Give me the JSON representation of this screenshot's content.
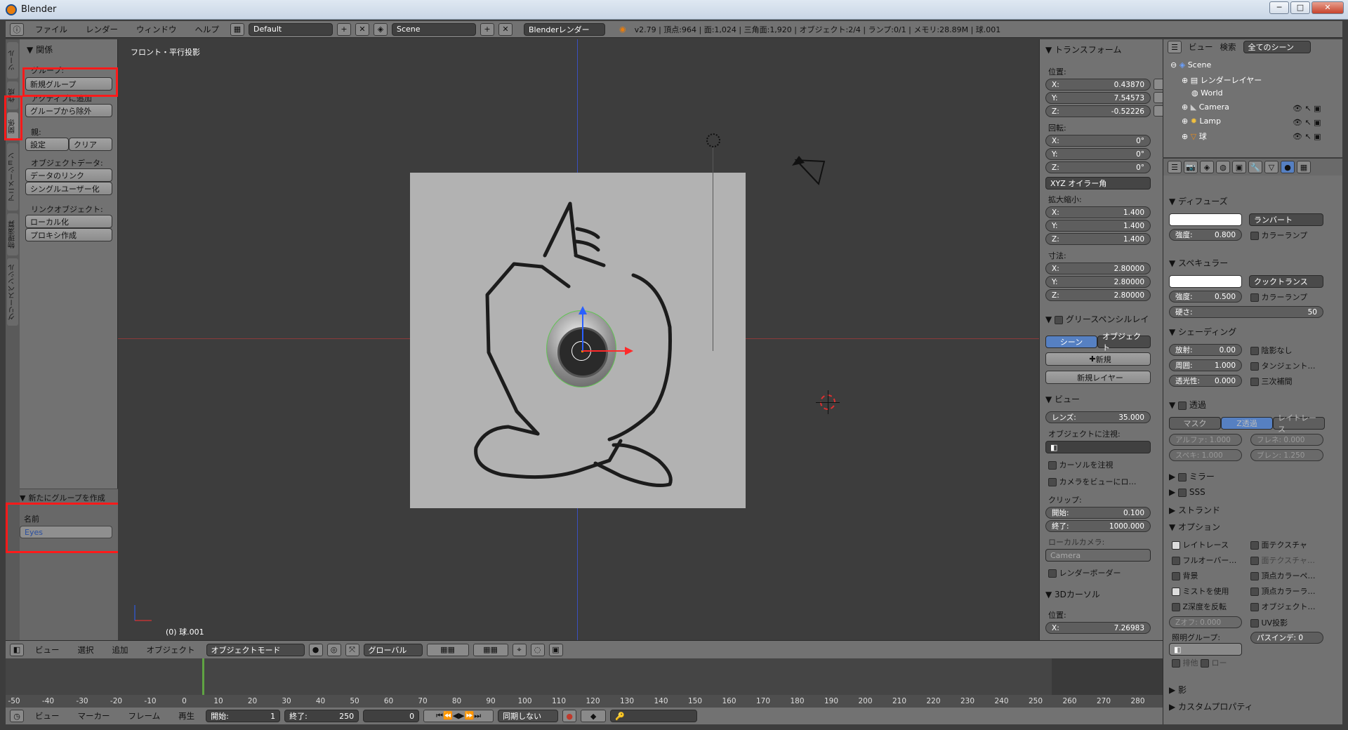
{
  "window": {
    "title": "Blender",
    "min": "─",
    "max": "□",
    "close": "✕"
  },
  "topbar": {
    "menus": [
      "ファイル",
      "レンダー",
      "ウィンドウ",
      "ヘルプ"
    ],
    "layout": "Default",
    "scene": "Scene",
    "engine": "Blenderレンダー",
    "stats": "v2.79 | 頂点:964 | 面:1,024 | 三角面:1,920 | オブジェクト:2/4 | ランプ:0/1 | メモリ:28.89M | 球.001"
  },
  "tool": {
    "tabs": [
      "ツール",
      "作成",
      "関係",
      "アニメーション",
      "物理演算",
      "グリースペンシル"
    ],
    "panel_title": "関係",
    "group_label": "グループ:",
    "btn_new_group": "新規グループ",
    "btn_add_active": "アクティブに追加",
    "btn_remove_group": "グループから除外",
    "parent_label": "親:",
    "btn_set": "設定",
    "btn_clear": "クリア",
    "objdata_label": "オブジェクトデータ:",
    "btn_link_data": "データのリンク",
    "btn_single_user": "シングルユーザー化",
    "linkobj_label": "リンクオブジェクト:",
    "btn_localize": "ローカル化",
    "btn_proxy": "プロキシ作成",
    "op_title": "新たにグループを作成",
    "name_label": "名前",
    "name_value": "Eyes"
  },
  "viewport": {
    "view_label": "フロント・平行投影",
    "object_label": "(0) 球.001"
  },
  "vheader": {
    "menus": [
      "ビュー",
      "選択",
      "追加",
      "オブジェクト"
    ],
    "mode": "オブジェクトモード",
    "orientation": "グローバル"
  },
  "timeline": {
    "ticks": [
      "-50",
      "-40",
      "-30",
      "-20",
      "-10",
      "0",
      "10",
      "20",
      "30",
      "40",
      "50",
      "60",
      "70",
      "80",
      "90",
      "100",
      "110",
      "120",
      "130",
      "140",
      "150",
      "160",
      "170",
      "180",
      "190",
      "200",
      "210",
      "220",
      "230",
      "240",
      "250",
      "260",
      "270",
      "280"
    ],
    "current": 0
  },
  "tlheader": {
    "menus": [
      "ビュー",
      "マーカー",
      "フレーム",
      "再生"
    ],
    "start": "開始:",
    "start_val": "1",
    "end": "終了:",
    "end_val": "250",
    "cur": "0",
    "sync": "同期しない"
  },
  "npanel": {
    "transform": "トランスフォーム",
    "location": "位置:",
    "loc": [
      "0.43870",
      "7.54573",
      "-0.52226"
    ],
    "rotation": "回転:",
    "rot": [
      "0°",
      "0°",
      "0°"
    ],
    "rotmode": "XYZ オイラー角",
    "scale": "拡大縮小:",
    "scl": [
      "1.400",
      "1.400",
      "1.400"
    ],
    "dims": "寸法:",
    "dim": [
      "2.80000",
      "2.80000",
      "2.80000"
    ],
    "axes": [
      "X:",
      "Y:",
      "Z:"
    ],
    "gp_title": "グリースペンシルレイ",
    "gp_scene": "シーン",
    "gp_object": "オブジェクト",
    "gp_new": "新規",
    "gp_newlayer": "新規レイヤー",
    "view": "ビュー",
    "lens_label": "レンズ:",
    "lens": "35.000",
    "lockobj": "オブジェクトに注視:",
    "lock_cursor": "カーソルを注視",
    "lock_camera": "カメラをビューにロ…",
    "clip": "クリップ:",
    "clip_start_label": "開始:",
    "clip_start": "0.100",
    "clip_end_label": "終了:",
    "clip_end": "1000.000",
    "local_cam": "ローカルカメラ:",
    "camera": "Camera",
    "render_border": "レンダーボーダー",
    "cursor3d": "3Dカーソル",
    "cursor_loc": "位置:",
    "cursor_x": "7.26983"
  },
  "outliner": {
    "view": "ビュー",
    "search": "検索",
    "all_scenes": "全てのシーン",
    "items": [
      "Scene",
      "レンダーレイヤー",
      "World",
      "Camera",
      "Lamp",
      "球"
    ]
  },
  "props": {
    "diffuse": "ディフューズ",
    "shader": "ランバート",
    "intensity_label": "強度:",
    "intensity": "0.800",
    "ramp": "カラーランプ",
    "specular": "スペキュラー",
    "spec_shader": "クックトランス",
    "spec_intensity": "0.500",
    "hardness_label": "硬さ:",
    "hardness": "50",
    "shading": "シェーディング",
    "emit_label": "放射:",
    "emit": "0.00",
    "ambient_label": "周囲:",
    "ambient": "1.000",
    "translucency_label": "透光性:",
    "translucency": "0.000",
    "shadeless": "陰影なし",
    "tangent": "タンジェント…",
    "cubic": "三次補間",
    "transparency": "透過",
    "mask": "マスク",
    "ztransp": "Z透過",
    "raytrace": "レイトレース",
    "alpha": "アルファ: 1.000",
    "fresnel": "フレネ: 0.000",
    "spec_a": "スペキ: 1.000",
    "blend": "ブレン: 1.250",
    "mirror": "ミラー",
    "sss": "SSS",
    "strand": "ストランド",
    "options": "オプション",
    "opt_raytrace": "レイトレース",
    "opt_faceTex": "面テクスチャ",
    "opt_fullover": "フルオーバー…",
    "opt_faceTexA": "面テクスチャ…",
    "opt_sky": "背景",
    "opt_vcolpaint": "頂点カラーペ…",
    "opt_mist": "ミストを使用",
    "opt_vcollight": "頂点カラーラ…",
    "opt_zinvert": "Z深度を反転",
    "opt_objcol": "オブジェクト…",
    "zoffset": "Zオフ: 0.000",
    "uvproj": "UV投影",
    "lightgroup": "照明グループ:",
    "passindex": "パスインデ: 0",
    "exclusive": "排他",
    "low": "ロー",
    "shadow": "影",
    "custom": "カスタムプロパティ"
  }
}
